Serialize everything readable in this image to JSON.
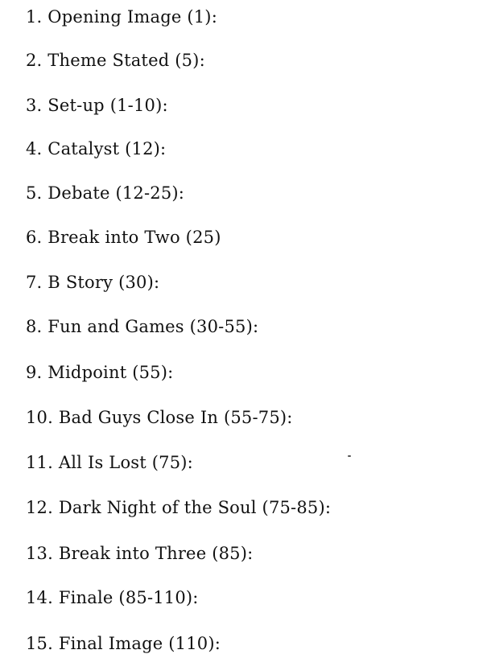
{
  "beats": [
    "1. Opening Image (1):",
    "2. Theme Stated (5):",
    "3. Set-up (1-10):",
    "4. Catalyst (12):",
    "5. Debate (12-25):",
    "6. Break into Two (25)",
    "7. B Story (30):",
    "8. Fun and Games (30-55):",
    "9. Midpoint (55):",
    "10. Bad Guys Close In (55-75):",
    "11. All Is Lost (75):",
    "12. Dark Night of the Soul (75-85):",
    "13. Break into Three (85):",
    "14. Finale (85-110):",
    "15. Final Image (110):"
  ]
}
